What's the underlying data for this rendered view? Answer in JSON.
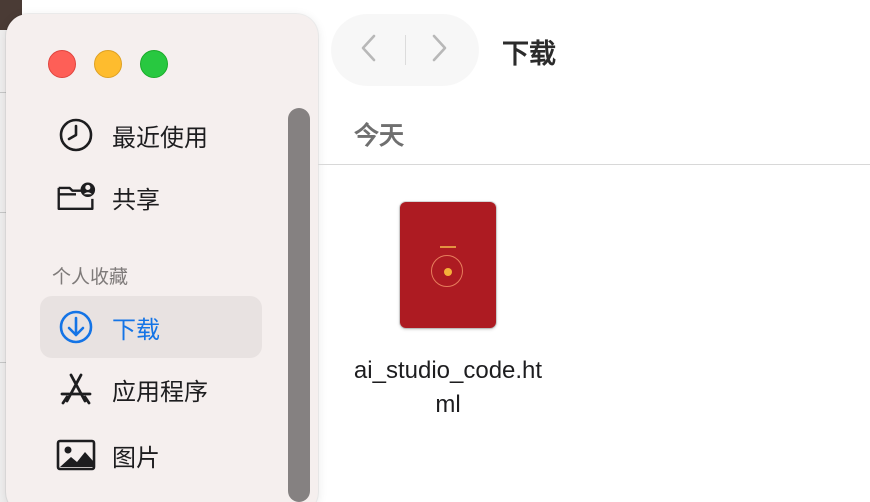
{
  "window": {
    "title": "下载"
  },
  "toolbar": {
    "back_icon": "chevron-left-icon",
    "forward_icon": "chevron-right-icon"
  },
  "sidebar": {
    "items_top": [
      {
        "label": "最近使用",
        "icon": "clock-icon"
      },
      {
        "label": "共享",
        "icon": "shared-folder-icon"
      }
    ],
    "section_title": "个人收藏",
    "favorites": [
      {
        "label": "下载",
        "icon": "download-circle-icon",
        "selected": true
      },
      {
        "label": "应用程序",
        "icon": "app-store-icon",
        "selected": false
      },
      {
        "label": "图片",
        "icon": "photo-icon",
        "selected": false
      }
    ]
  },
  "content": {
    "group_title": "今天",
    "files": [
      {
        "name_line1": "ai_studio_code.ht",
        "name_line2": "ml",
        "icon": "html-document-thumbnail"
      }
    ]
  },
  "colors": {
    "accent": "#1474e6",
    "thumbnail_red": "#ad1b22",
    "traffic_red": "#fe5f57",
    "traffic_yellow": "#febc2e",
    "traffic_green": "#28c840"
  }
}
